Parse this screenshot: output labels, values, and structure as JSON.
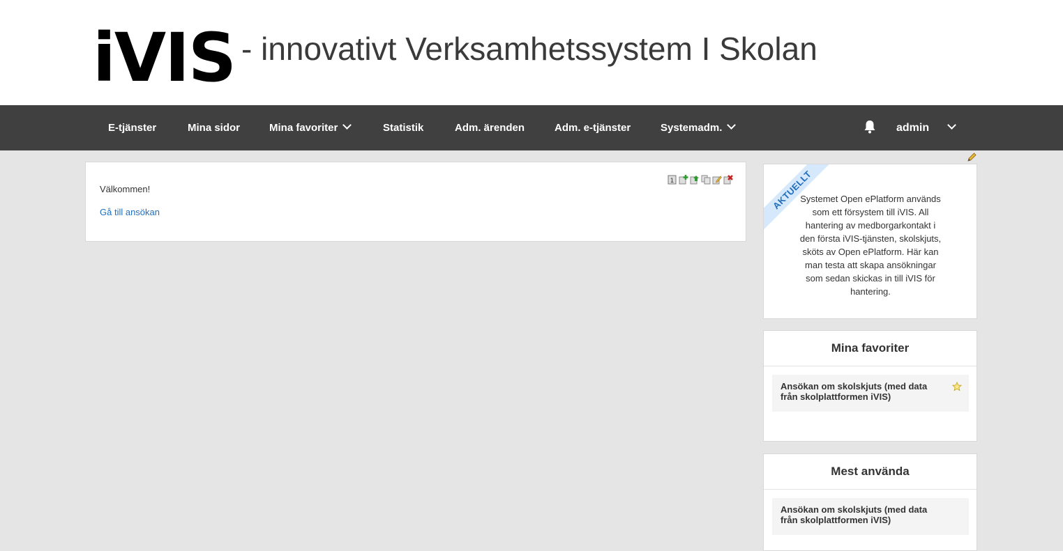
{
  "header": {
    "logo_text": "iVIS",
    "tagline": "- innovativt Verksamhetssystem I Skolan"
  },
  "nav": {
    "items": [
      {
        "label": "E-tjänster"
      },
      {
        "label": "Mina sidor"
      },
      {
        "label": "Mina favoriter",
        "has_dropdown": true
      },
      {
        "label": "Statistik"
      },
      {
        "label": "Adm. ärenden"
      },
      {
        "label": "Adm. e-tjänster"
      },
      {
        "label": "Systemadm.",
        "has_dropdown": true
      }
    ],
    "user": "admin",
    "icons": [
      "bell-icon",
      "chevron-down-icon"
    ],
    "background_color": "#404040"
  },
  "main": {
    "welcome": "Välkommen!",
    "apply_link": "Gå till ansökan",
    "toolbar_icons": [
      "page-number-icon",
      "add-icon",
      "move-icon",
      "copy-icon",
      "edit-icon",
      "delete-icon"
    ],
    "toolbar_page_number": "1"
  },
  "sidebar": {
    "news": {
      "ribbon": "AKTUELLT",
      "text": "Systemet Open ePlatform används som ett försystem till iVIS. All hantering av medborgarkontakt i den första iVIS-tjänsten, skolskjuts, sköts av Open ePlatform. Här kan man testa att skapa ansökningar som sedan skickas in till iVIS för hantering."
    },
    "favorites": {
      "title": "Mina favoriter",
      "items": [
        {
          "label": "Ansökan om skolskjuts (med data från skolplattformen iVIS)"
        }
      ]
    },
    "most_used": {
      "title": "Mest använda",
      "items": [
        {
          "label": "Ansökan om skolskjuts (med data från skolplattformen iVIS)"
        }
      ]
    }
  },
  "colors": {
    "link": "#1f6fbf",
    "background": "#e5e5e5",
    "ribbon": "#d6e8fb"
  }
}
